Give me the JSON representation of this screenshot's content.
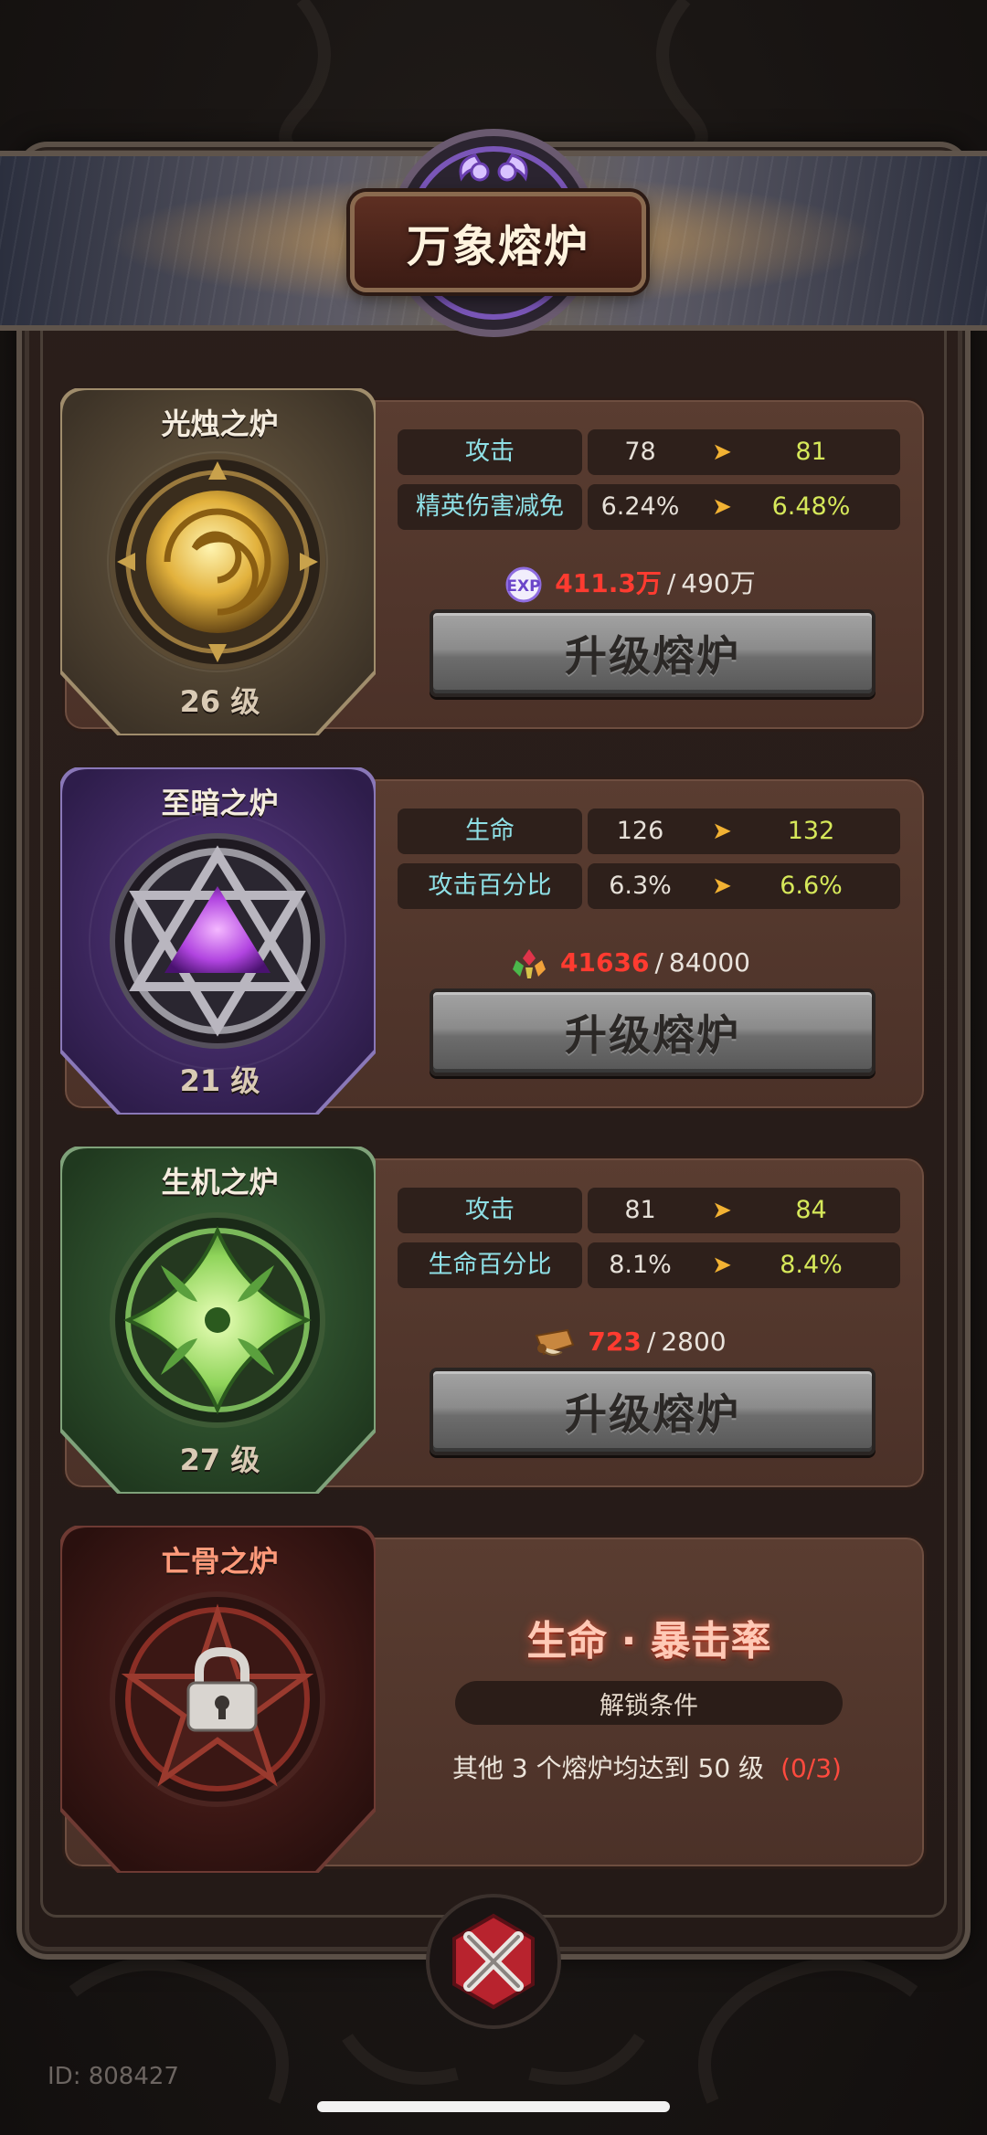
{
  "header": {
    "title": "万象熔炉"
  },
  "furnaces": [
    {
      "name": "光烛之炉",
      "level": "26 级",
      "stats": [
        {
          "name": "攻击",
          "old": "78",
          "new": "81"
        },
        {
          "name": "精英伤害减免",
          "old": "6.24%",
          "new": "6.48%"
        }
      ],
      "cost": {
        "icon": "exp-icon",
        "current": "411.3万",
        "sep": "/",
        "max": "490万"
      },
      "button": "升级熔炉"
    },
    {
      "name": "至暗之炉",
      "level": "21 级",
      "stats": [
        {
          "name": "生命",
          "old": "126",
          "new": "132"
        },
        {
          "name": "攻击百分比",
          "old": "6.3%",
          "new": "6.6%"
        }
      ],
      "cost": {
        "icon": "gem-cluster-icon",
        "current": "41636",
        "sep": "/",
        "max": "84000"
      },
      "button": "升级熔炉"
    },
    {
      "name": "生机之炉",
      "level": "27 级",
      "stats": [
        {
          "name": "攻击",
          "old": "81",
          "new": "84"
        },
        {
          "name": "生命百分比",
          "old": "8.1%",
          "new": "8.4%"
        }
      ],
      "cost": {
        "icon": "scroll-icon",
        "current": "723",
        "sep": "/",
        "max": "2800"
      },
      "button": "升级熔炉"
    }
  ],
  "locked_furnace": {
    "name": "亡骨之炉",
    "stat": "生命 · 暴击率",
    "unlock_label": "解锁条件",
    "condition": "其他 3 个熔炉均达到 50 级",
    "progress": "(0/3)"
  },
  "footer": {
    "id": "ID: 808427"
  },
  "arrow_glyph": "➤",
  "colors": {
    "cost_current": "#ff3b30",
    "stat_new": "#d6e85a",
    "stat_name": "#8fe0e6",
    "arrow": "#f2b233"
  }
}
